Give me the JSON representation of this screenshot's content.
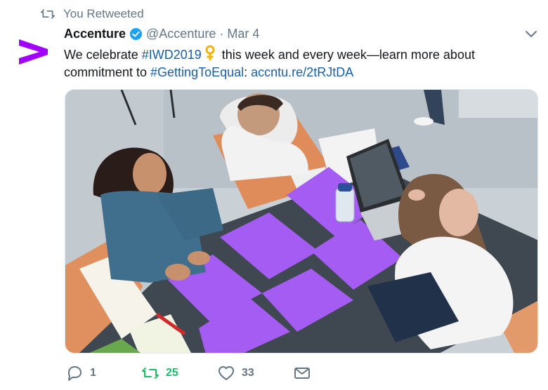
{
  "context": {
    "label": "You Retweeted"
  },
  "tweet": {
    "author_name": "Accenture",
    "handle": "@Accenture",
    "separator": "·",
    "date": "Mar 4",
    "text_part1": "We celebrate ",
    "hashtag1": "#IWD2019",
    "text_part2": " this week and every week—learn more about commitment to ",
    "hashtag2": "#GettingToEqual",
    "text_part3": ": ",
    "link": "accntu.re/2tRJtDA"
  },
  "actions": {
    "reply_count": "1",
    "retweet_count": "25",
    "like_count": "33"
  },
  "colors": {
    "brand_purple": "#a100ff",
    "link_blue": "#1b5ea8",
    "retweet_green": "#17bf63",
    "muted_gray": "#657786",
    "verified_blue": "#1da1f2",
    "emoji_gold": "#f4b400"
  },
  "icons": {
    "context": "retweet-icon",
    "verified": "verified-badge-icon",
    "caret": "chevron-down-icon",
    "emoji": "female-sign-icon",
    "reply": "reply-icon",
    "retweet": "retweet-icon",
    "like": "heart-icon",
    "dm": "envelope-icon"
  }
}
